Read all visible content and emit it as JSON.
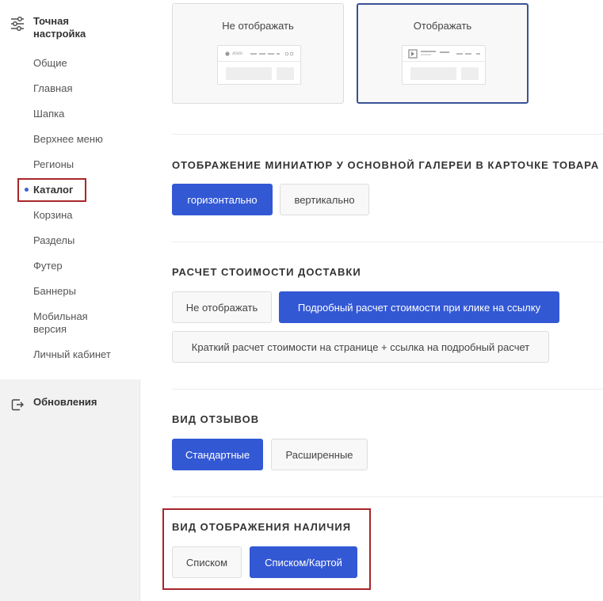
{
  "sidebar": {
    "fine_tune_title": "Точная настройка",
    "items": [
      {
        "label": "Общие"
      },
      {
        "label": "Главная"
      },
      {
        "label": "Шапка"
      },
      {
        "label": "Верхнее меню"
      },
      {
        "label": "Регионы"
      },
      {
        "label": "Каталог"
      },
      {
        "label": "Корзина"
      },
      {
        "label": "Разделы"
      },
      {
        "label": "Футер"
      },
      {
        "label": "Баннеры"
      },
      {
        "label": "Мобильная версия"
      },
      {
        "label": "Личный кабинет"
      }
    ],
    "active_item": "Каталог",
    "updates_title": "Обновления",
    "fine_tune_icon": "sliders-icon",
    "updates_icon": "update-icon"
  },
  "logo_display": {
    "options": [
      {
        "label": "Не отображать",
        "mock_logo_text": "лого",
        "selected": false
      },
      {
        "label": "Отображать",
        "selected": true
      }
    ]
  },
  "thumbnails": {
    "title": "ОТОБРАЖЕНИЕ МИНИАТЮР У ОСНОВНОЙ ГАЛЕРЕИ В КАРТОЧКЕ ТОВАРА",
    "options": [
      {
        "label": "горизонтально",
        "selected": true
      },
      {
        "label": "вертикально",
        "selected": false
      }
    ]
  },
  "delivery": {
    "title": "РАСЧЕТ СТОИМОСТИ ДОСТАВКИ",
    "options": [
      {
        "label": "Не отображать",
        "selected": false
      },
      {
        "label": "Подробный расчет стоимости при клике на ссылку",
        "selected": true
      },
      {
        "label": "Краткий расчет стоимости на странице + ссылка на подробный расчет",
        "selected": false
      }
    ]
  },
  "reviews": {
    "title": "ВИД ОТЗЫВОВ",
    "options": [
      {
        "label": "Стандартные",
        "selected": true
      },
      {
        "label": "Расширенные",
        "selected": false
      }
    ]
  },
  "availability": {
    "title": "ВИД ОТОБРАЖЕНИЯ НАЛИЧИЯ",
    "options": [
      {
        "label": "Списком",
        "selected": false
      },
      {
        "label": "Списком/Картой",
        "selected": true
      }
    ]
  },
  "colors": {
    "accent": "#3358d4",
    "highlight_border": "#a8262a",
    "selected_card_border": "#3a5297",
    "sidebar_bottom_bg": "#f2f2f2"
  }
}
